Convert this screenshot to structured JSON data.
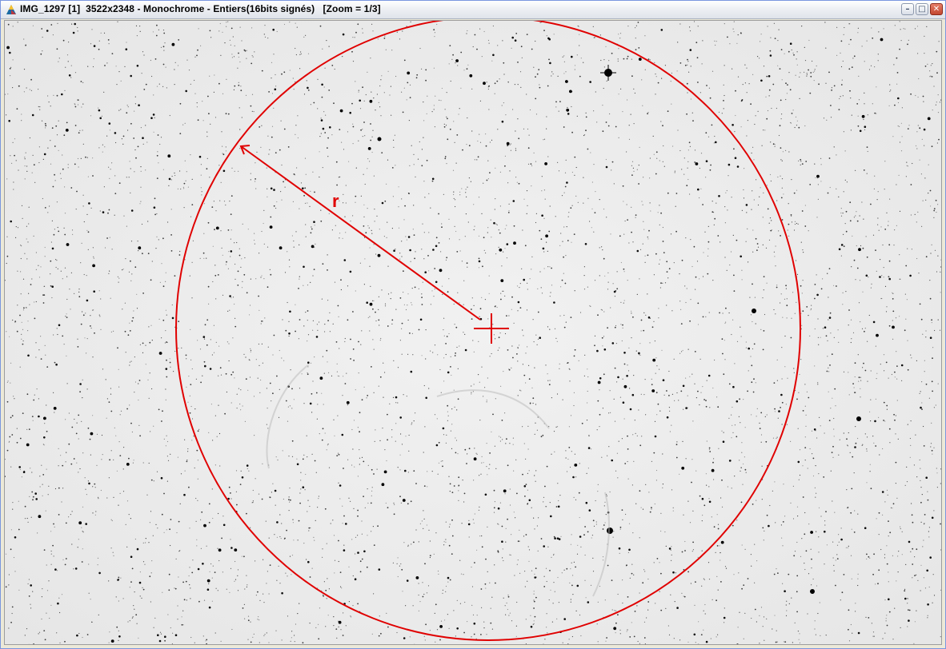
{
  "window": {
    "title": "IMG_1297 [1]  3522x2348 - Monochrome - Entiers(16bits signés)   [Zoom = 1/3]",
    "icon": "prism-app-icon",
    "controls": {
      "minimize_icon": "minimize-icon",
      "maximize_icon": "maximize-icon",
      "close_icon": "close-icon"
    }
  },
  "image": {
    "description_colors": {
      "background": "#efefef",
      "stars": "#000000",
      "overlay": "#e00000"
    },
    "overlay": {
      "radius_label": "r"
    }
  }
}
